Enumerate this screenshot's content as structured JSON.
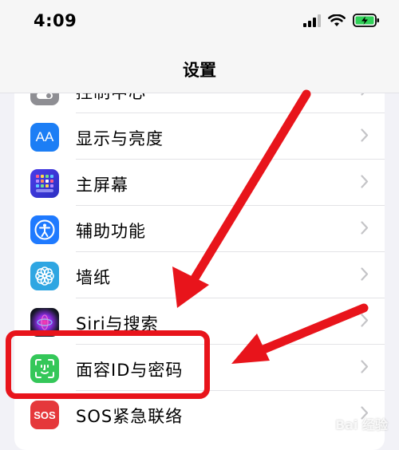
{
  "status_bar": {
    "time": "4:09"
  },
  "nav": {
    "title": "设置"
  },
  "rows": [
    {
      "label": "控制中心"
    },
    {
      "label": "显示与亮度",
      "icon_text": "AA"
    },
    {
      "label": "主屏幕"
    },
    {
      "label": "辅助功能"
    },
    {
      "label": "墙纸"
    },
    {
      "label": "Siri与搜索"
    },
    {
      "label": "面容ID与密码"
    },
    {
      "label": "SOS紧急联络",
      "icon_text": "SOS"
    }
  ],
  "watermark": {
    "text": "Bai 经验"
  },
  "colors": {
    "annotation": "#e8141b",
    "display_icon": "#1c7ef5",
    "homescreen_icon": "#3a34d8",
    "accessibility_icon": "#1f7aff",
    "wallpaper_icon": "#2fa6e2",
    "faceid_icon": "#34c759",
    "sos_icon": "#e5383b",
    "battery": "#30d158"
  }
}
